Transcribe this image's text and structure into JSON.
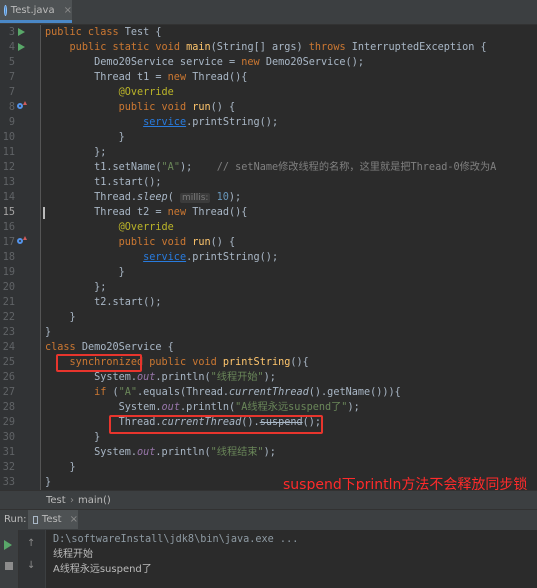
{
  "tab": {
    "label": "Test.java",
    "close": "×"
  },
  "code_lines": [
    {
      "num": "3",
      "gutter": "run",
      "segs": [
        [
          "kw",
          "public class "
        ],
        [
          "",
          "Test {"
        ]
      ]
    },
    {
      "num": "4",
      "gutter": "run",
      "segs": [
        [
          "",
          "    "
        ],
        [
          "kw",
          "public static void "
        ],
        [
          "fn",
          "main"
        ],
        [
          "",
          "(String[] args) "
        ],
        [
          "kw",
          "throws "
        ],
        [
          "",
          "InterruptedException {"
        ]
      ]
    },
    {
      "num": "5",
      "segs": [
        [
          "",
          "        Demo20Service service = "
        ],
        [
          "kw",
          "new "
        ],
        [
          "",
          "Demo20Service();"
        ]
      ]
    },
    {
      "num": "7",
      "segs": [
        [
          "",
          "        Thread t1 = "
        ],
        [
          "kw",
          "new "
        ],
        [
          "",
          "Thread(){"
        ]
      ]
    },
    {
      "num": "7",
      "segs": [
        [
          "",
          "            "
        ],
        [
          "ann",
          "@Override"
        ]
      ]
    },
    {
      "num": "8",
      "gutter": "override",
      "segs": [
        [
          "",
          "            "
        ],
        [
          "kw",
          "public void "
        ],
        [
          "fn",
          "run"
        ],
        [
          "",
          "() {"
        ]
      ]
    },
    {
      "num": "9",
      "segs": [
        [
          "",
          "                "
        ],
        [
          "link",
          "service"
        ],
        [
          "",
          ".printString();"
        ]
      ]
    },
    {
      "num": "10",
      "segs": [
        [
          "",
          "            }"
        ]
      ]
    },
    {
      "num": "11",
      "segs": [
        [
          "",
          "        };"
        ]
      ]
    },
    {
      "num": "12",
      "segs": [
        [
          "",
          "        t1.setName("
        ],
        [
          "str",
          "\"A\""
        ],
        [
          "",
          ");    "
        ],
        [
          "cmt",
          "// setName修改线程的名称，这里就是把Thread-0修改为A"
        ]
      ]
    },
    {
      "num": "13",
      "segs": [
        [
          "",
          "        t1.start();"
        ]
      ]
    },
    {
      "num": "14",
      "segs": [
        [
          "",
          "        Thread."
        ],
        [
          "it",
          "sleep"
        ],
        [
          "",
          "( "
        ],
        [
          "hint",
          "millis:"
        ],
        [
          "",
          ""
        ],
        [
          "num",
          " 10"
        ],
        [
          "",
          ");"
        ]
      ]
    },
    {
      "num": "15",
      "current": true,
      "segs": [
        [
          "",
          "        Thread t2 = "
        ],
        [
          "kw",
          "new "
        ],
        [
          "",
          "Thread(){"
        ]
      ]
    },
    {
      "num": "16",
      "segs": [
        [
          "",
          "            "
        ],
        [
          "ann",
          "@Override"
        ]
      ]
    },
    {
      "num": "17",
      "gutter": "override",
      "segs": [
        [
          "",
          "            "
        ],
        [
          "kw",
          "public void "
        ],
        [
          "fn",
          "run"
        ],
        [
          "",
          "() {"
        ]
      ]
    },
    {
      "num": "18",
      "segs": [
        [
          "",
          "                "
        ],
        [
          "link",
          "service"
        ],
        [
          "",
          ".printString();"
        ]
      ]
    },
    {
      "num": "19",
      "segs": [
        [
          "",
          "            }"
        ]
      ]
    },
    {
      "num": "20",
      "segs": [
        [
          "",
          "        };"
        ]
      ]
    },
    {
      "num": "21",
      "segs": [
        [
          "",
          "        t2.start();"
        ]
      ]
    },
    {
      "num": "22",
      "segs": [
        [
          "",
          "    }"
        ]
      ]
    },
    {
      "num": "23",
      "segs": [
        [
          "",
          "}"
        ]
      ]
    },
    {
      "num": "24",
      "segs": [
        [
          "kw",
          "class "
        ],
        [
          "",
          "Demo20Service {"
        ]
      ]
    },
    {
      "num": "25",
      "segs": [
        [
          "",
          "    "
        ],
        [
          "kw",
          "synchronized "
        ],
        [
          "kw",
          "public void "
        ],
        [
          "fn",
          "printString"
        ],
        [
          "",
          "(){"
        ]
      ]
    },
    {
      "num": "26",
      "segs": [
        [
          "",
          "        System."
        ],
        [
          "fld",
          "out"
        ],
        [
          "",
          ".println("
        ],
        [
          "str",
          "\"线程开始\""
        ],
        [
          "",
          ");"
        ]
      ]
    },
    {
      "num": "27",
      "segs": [
        [
          "",
          "        "
        ],
        [
          "kw",
          "if "
        ],
        [
          "",
          "("
        ],
        [
          "str",
          "\"A\""
        ],
        [
          "",
          ".equals(Thread."
        ],
        [
          "it",
          "currentThread"
        ],
        [
          "",
          "().getName())){"
        ]
      ]
    },
    {
      "num": "28",
      "segs": [
        [
          "",
          "            System."
        ],
        [
          "fld",
          "out"
        ],
        [
          "",
          ".println("
        ],
        [
          "str",
          "\"A线程永远suspend了\""
        ],
        [
          "",
          ");"
        ]
      ]
    },
    {
      "num": "29",
      "segs": [
        [
          "",
          "            Thread."
        ],
        [
          "it",
          "currentThread"
        ],
        [
          "",
          "()."
        ],
        [
          "strike",
          "suspend"
        ],
        [
          "",
          "();"
        ]
      ]
    },
    {
      "num": "30",
      "segs": [
        [
          "",
          "        }"
        ]
      ]
    },
    {
      "num": "31",
      "segs": [
        [
          "",
          "        System."
        ],
        [
          "fld",
          "out"
        ],
        [
          "",
          ".println("
        ],
        [
          "str",
          "\"线程结束\""
        ],
        [
          "",
          ");"
        ]
      ]
    },
    {
      "num": "32",
      "segs": [
        [
          "",
          "    }"
        ]
      ]
    },
    {
      "num": "33",
      "segs": [
        [
          "",
          "}"
        ]
      ]
    }
  ],
  "annotation": "suspend下println方法不会释放同步锁",
  "breadcrumb": {
    "first": "Test",
    "sep": "›",
    "second": "main()"
  },
  "run_panel": {
    "label": "Run:",
    "tab": "Test",
    "close": "×"
  },
  "console_lines": [
    {
      "kind": "cmd",
      "text": "D:\\softwareInstall\\jdk8\\bin\\java.exe ..."
    },
    {
      "kind": "zh",
      "text": "线程开始"
    },
    {
      "kind": "zh",
      "text": "A线程永远suspend了"
    }
  ],
  "colors": {
    "accent": "#4a88c7",
    "highlight_red": "#e8352d",
    "annotation_red": "#ff2b2b"
  }
}
